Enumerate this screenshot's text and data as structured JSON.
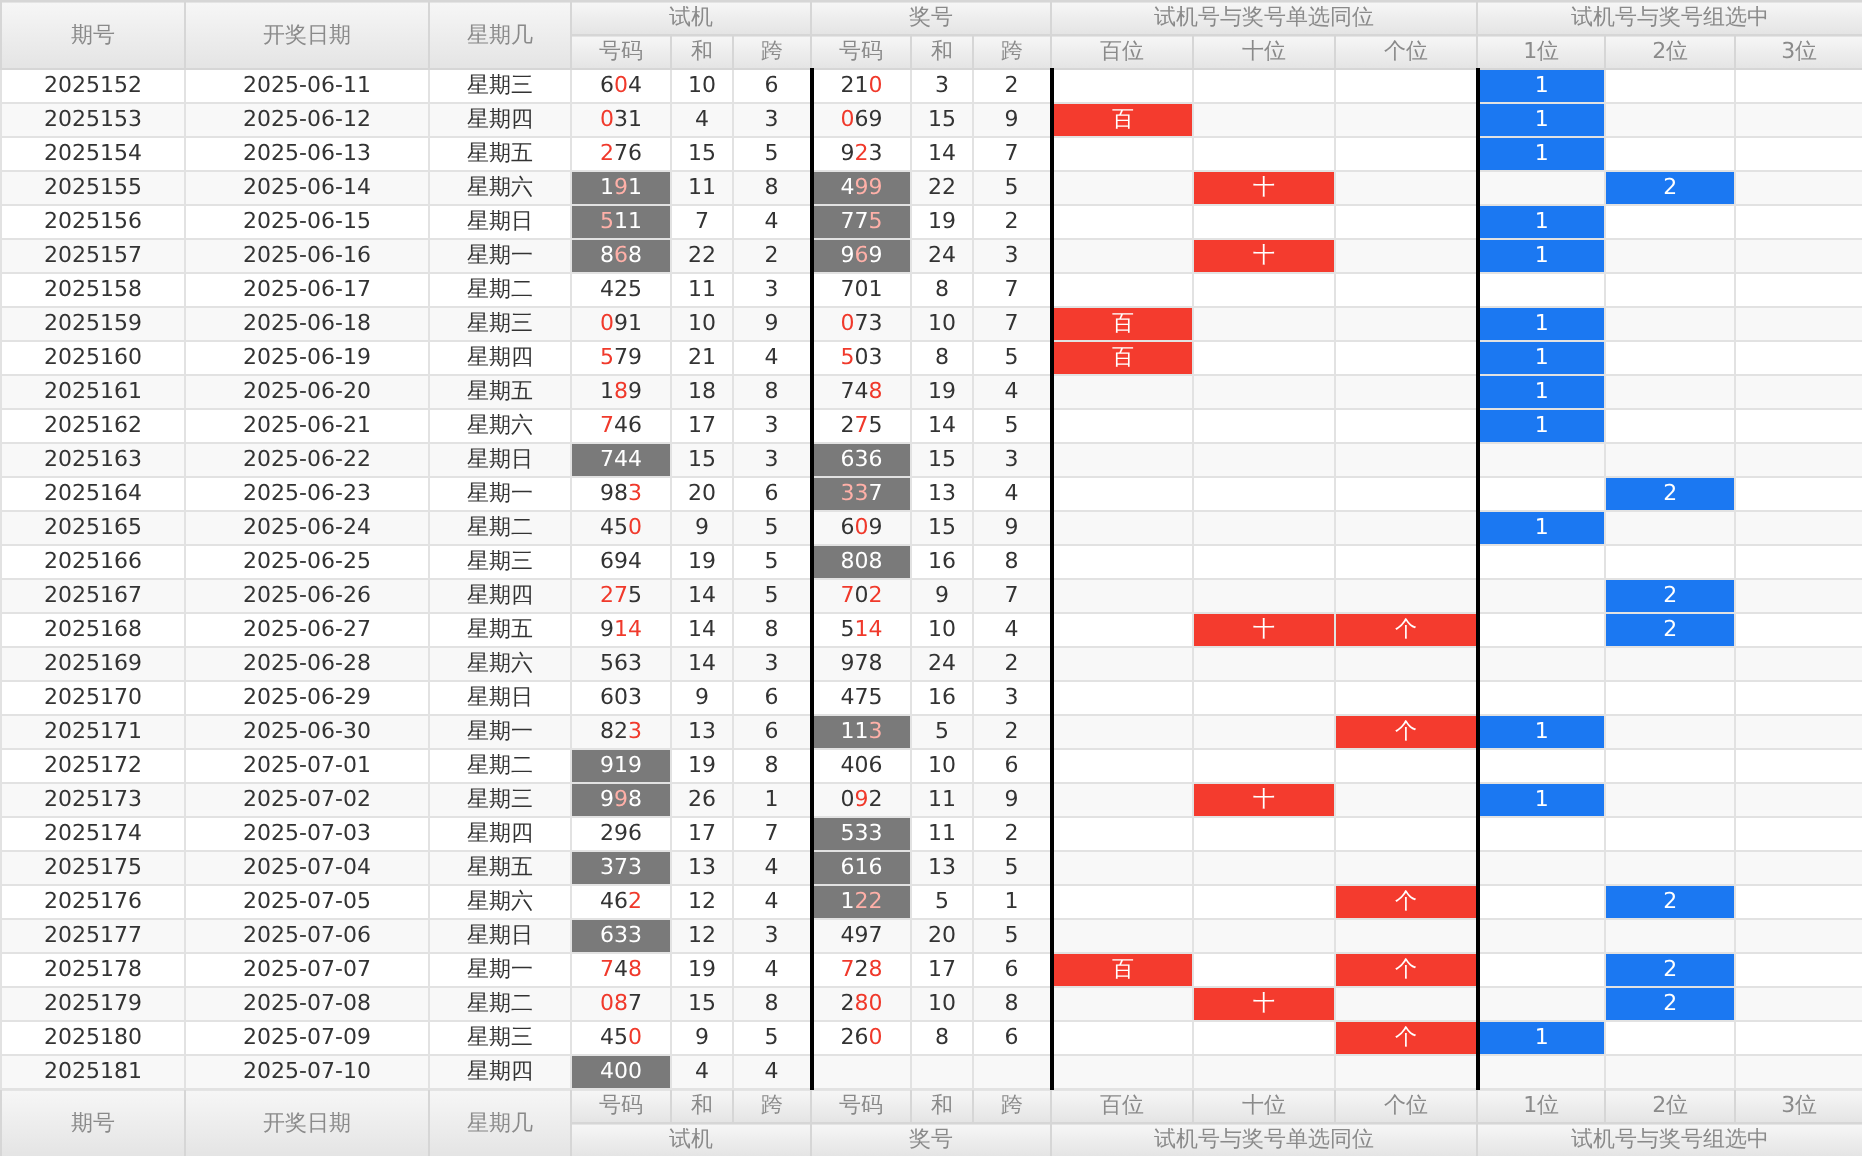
{
  "header": {
    "period": "期号",
    "date": "开奖日期",
    "weekday": "星期几",
    "groups": [
      "试机",
      "奖号",
      "试机号与奖号单选同位",
      "试机号与奖号组选中"
    ],
    "columns": [
      "号码",
      "和",
      "跨",
      "号码",
      "和",
      "跨",
      "百位",
      "十位",
      "个位",
      "1位",
      "2位",
      "3位"
    ]
  },
  "footer": {
    "period": "期号",
    "date": "开奖日期",
    "weekday": "星期几",
    "columns": [
      "号码",
      "和",
      "跨",
      "号码",
      "和",
      "跨",
      "百位",
      "十位",
      "个位",
      "1位",
      "2位",
      "3位"
    ],
    "groups": [
      "试机",
      "奖号",
      "试机号与奖号单选同位",
      "试机号与奖号组选中"
    ]
  },
  "rows": [
    {
      "period": "2025152",
      "date": "2025-06-11",
      "weekday": "星期三",
      "test": {
        "code": "604",
        "hits": [
          false,
          true,
          false
        ],
        "shaded": false,
        "sum": "10",
        "span": "6"
      },
      "draw": {
        "code": "210",
        "hits": [
          false,
          false,
          true
        ],
        "shaded": false,
        "sum": "3",
        "span": "2"
      },
      "single": {},
      "group": {
        "first": "1"
      }
    },
    {
      "period": "2025153",
      "date": "2025-06-12",
      "weekday": "星期四",
      "test": {
        "code": "031",
        "hits": [
          true,
          false,
          false
        ],
        "shaded": false,
        "sum": "4",
        "span": "3"
      },
      "draw": {
        "code": "069",
        "hits": [
          true,
          false,
          false
        ],
        "shaded": false,
        "sum": "15",
        "span": "9"
      },
      "single": {
        "hundreds": "百"
      },
      "group": {
        "first": "1"
      }
    },
    {
      "period": "2025154",
      "date": "2025-06-13",
      "weekday": "星期五",
      "test": {
        "code": "276",
        "hits": [
          true,
          false,
          false
        ],
        "shaded": false,
        "sum": "15",
        "span": "5"
      },
      "draw": {
        "code": "923",
        "hits": [
          false,
          true,
          false
        ],
        "shaded": false,
        "sum": "14",
        "span": "7"
      },
      "single": {},
      "group": {
        "first": "1"
      }
    },
    {
      "period": "2025155",
      "date": "2025-06-14",
      "weekday": "星期六",
      "test": {
        "code": "191",
        "hits": [
          false,
          true,
          false
        ],
        "shaded": true,
        "sum": "11",
        "span": "8"
      },
      "draw": {
        "code": "499",
        "hits": [
          false,
          true,
          true
        ],
        "shaded": true,
        "sum": "22",
        "span": "5"
      },
      "single": {
        "tens": "十"
      },
      "group": {
        "second": "2"
      }
    },
    {
      "period": "2025156",
      "date": "2025-06-15",
      "weekday": "星期日",
      "test": {
        "code": "511",
        "hits": [
          true,
          false,
          false
        ],
        "shaded": true,
        "sum": "7",
        "span": "4"
      },
      "draw": {
        "code": "775",
        "hits": [
          false,
          false,
          true
        ],
        "shaded": true,
        "sum": "19",
        "span": "2"
      },
      "single": {},
      "group": {
        "first": "1"
      }
    },
    {
      "period": "2025157",
      "date": "2025-06-16",
      "weekday": "星期一",
      "test": {
        "code": "868",
        "hits": [
          false,
          true,
          false
        ],
        "shaded": true,
        "sum": "22",
        "span": "2"
      },
      "draw": {
        "code": "969",
        "hits": [
          false,
          true,
          false
        ],
        "shaded": true,
        "sum": "24",
        "span": "3"
      },
      "single": {
        "tens": "十"
      },
      "group": {
        "first": "1"
      }
    },
    {
      "period": "2025158",
      "date": "2025-06-17",
      "weekday": "星期二",
      "test": {
        "code": "425",
        "hits": [
          false,
          false,
          false
        ],
        "shaded": false,
        "sum": "11",
        "span": "3"
      },
      "draw": {
        "code": "701",
        "hits": [
          false,
          false,
          false
        ],
        "shaded": false,
        "sum": "8",
        "span": "7"
      },
      "single": {},
      "group": {}
    },
    {
      "period": "2025159",
      "date": "2025-06-18",
      "weekday": "星期三",
      "test": {
        "code": "091",
        "hits": [
          true,
          false,
          false
        ],
        "shaded": false,
        "sum": "10",
        "span": "9"
      },
      "draw": {
        "code": "073",
        "hits": [
          true,
          false,
          false
        ],
        "shaded": false,
        "sum": "10",
        "span": "7"
      },
      "single": {
        "hundreds": "百"
      },
      "group": {
        "first": "1"
      }
    },
    {
      "period": "2025160",
      "date": "2025-06-19",
      "weekday": "星期四",
      "test": {
        "code": "579",
        "hits": [
          true,
          false,
          false
        ],
        "shaded": false,
        "sum": "21",
        "span": "4"
      },
      "draw": {
        "code": "503",
        "hits": [
          true,
          false,
          false
        ],
        "shaded": false,
        "sum": "8",
        "span": "5"
      },
      "single": {
        "hundreds": "百"
      },
      "group": {
        "first": "1"
      }
    },
    {
      "period": "2025161",
      "date": "2025-06-20",
      "weekday": "星期五",
      "test": {
        "code": "189",
        "hits": [
          false,
          true,
          false
        ],
        "shaded": false,
        "sum": "18",
        "span": "8"
      },
      "draw": {
        "code": "748",
        "hits": [
          false,
          false,
          true
        ],
        "shaded": false,
        "sum": "19",
        "span": "4"
      },
      "single": {},
      "group": {
        "first": "1"
      }
    },
    {
      "period": "2025162",
      "date": "2025-06-21",
      "weekday": "星期六",
      "test": {
        "code": "746",
        "hits": [
          true,
          false,
          false
        ],
        "shaded": false,
        "sum": "17",
        "span": "3"
      },
      "draw": {
        "code": "275",
        "hits": [
          false,
          true,
          false
        ],
        "shaded": false,
        "sum": "14",
        "span": "5"
      },
      "single": {},
      "group": {
        "first": "1"
      }
    },
    {
      "period": "2025163",
      "date": "2025-06-22",
      "weekday": "星期日",
      "test": {
        "code": "744",
        "hits": [
          false,
          false,
          false
        ],
        "shaded": true,
        "sum": "15",
        "span": "3"
      },
      "draw": {
        "code": "636",
        "hits": [
          false,
          false,
          false
        ],
        "shaded": true,
        "sum": "15",
        "span": "3"
      },
      "single": {},
      "group": {}
    },
    {
      "period": "2025164",
      "date": "2025-06-23",
      "weekday": "星期一",
      "test": {
        "code": "983",
        "hits": [
          false,
          false,
          true
        ],
        "shaded": false,
        "sum": "20",
        "span": "6"
      },
      "draw": {
        "code": "337",
        "hits": [
          true,
          true,
          false
        ],
        "shaded": true,
        "sum": "13",
        "span": "4"
      },
      "single": {},
      "group": {
        "second": "2"
      }
    },
    {
      "period": "2025165",
      "date": "2025-06-24",
      "weekday": "星期二",
      "test": {
        "code": "450",
        "hits": [
          false,
          false,
          true
        ],
        "shaded": false,
        "sum": "9",
        "span": "5"
      },
      "draw": {
        "code": "609",
        "hits": [
          false,
          true,
          false
        ],
        "shaded": false,
        "sum": "15",
        "span": "9"
      },
      "single": {},
      "group": {
        "first": "1"
      }
    },
    {
      "period": "2025166",
      "date": "2025-06-25",
      "weekday": "星期三",
      "test": {
        "code": "694",
        "hits": [
          false,
          false,
          false
        ],
        "shaded": false,
        "sum": "19",
        "span": "5"
      },
      "draw": {
        "code": "808",
        "hits": [
          false,
          false,
          false
        ],
        "shaded": true,
        "sum": "16",
        "span": "8"
      },
      "single": {},
      "group": {}
    },
    {
      "period": "2025167",
      "date": "2025-06-26",
      "weekday": "星期四",
      "test": {
        "code": "275",
        "hits": [
          true,
          true,
          false
        ],
        "shaded": false,
        "sum": "14",
        "span": "5"
      },
      "draw": {
        "code": "702",
        "hits": [
          true,
          false,
          true
        ],
        "shaded": false,
        "sum": "9",
        "span": "7"
      },
      "single": {},
      "group": {
        "second": "2"
      }
    },
    {
      "period": "2025168",
      "date": "2025-06-27",
      "weekday": "星期五",
      "test": {
        "code": "914",
        "hits": [
          false,
          true,
          true
        ],
        "shaded": false,
        "sum": "14",
        "span": "8"
      },
      "draw": {
        "code": "514",
        "hits": [
          false,
          true,
          true
        ],
        "shaded": false,
        "sum": "10",
        "span": "4"
      },
      "single": {
        "tens": "十",
        "units": "个"
      },
      "group": {
        "second": "2"
      }
    },
    {
      "period": "2025169",
      "date": "2025-06-28",
      "weekday": "星期六",
      "test": {
        "code": "563",
        "hits": [
          false,
          false,
          false
        ],
        "shaded": false,
        "sum": "14",
        "span": "3"
      },
      "draw": {
        "code": "978",
        "hits": [
          false,
          false,
          false
        ],
        "shaded": false,
        "sum": "24",
        "span": "2"
      },
      "single": {},
      "group": {}
    },
    {
      "period": "2025170",
      "date": "2025-06-29",
      "weekday": "星期日",
      "test": {
        "code": "603",
        "hits": [
          false,
          false,
          false
        ],
        "shaded": false,
        "sum": "9",
        "span": "6"
      },
      "draw": {
        "code": "475",
        "hits": [
          false,
          false,
          false
        ],
        "shaded": false,
        "sum": "16",
        "span": "3"
      },
      "single": {},
      "group": {}
    },
    {
      "period": "2025171",
      "date": "2025-06-30",
      "weekday": "星期一",
      "test": {
        "code": "823",
        "hits": [
          false,
          false,
          true
        ],
        "shaded": false,
        "sum": "13",
        "span": "6"
      },
      "draw": {
        "code": "113",
        "hits": [
          false,
          false,
          true
        ],
        "shaded": true,
        "sum": "5",
        "span": "2"
      },
      "single": {
        "units": "个"
      },
      "group": {
        "first": "1"
      }
    },
    {
      "period": "2025172",
      "date": "2025-07-01",
      "weekday": "星期二",
      "test": {
        "code": "919",
        "hits": [
          false,
          false,
          false
        ],
        "shaded": true,
        "sum": "19",
        "span": "8"
      },
      "draw": {
        "code": "406",
        "hits": [
          false,
          false,
          false
        ],
        "shaded": false,
        "sum": "10",
        "span": "6"
      },
      "single": {},
      "group": {}
    },
    {
      "period": "2025173",
      "date": "2025-07-02",
      "weekday": "星期三",
      "test": {
        "code": "998",
        "hits": [
          false,
          true,
          false
        ],
        "shaded": true,
        "sum": "26",
        "span": "1"
      },
      "draw": {
        "code": "092",
        "hits": [
          false,
          true,
          false
        ],
        "shaded": false,
        "sum": "11",
        "span": "9"
      },
      "single": {
        "tens": "十"
      },
      "group": {
        "first": "1"
      }
    },
    {
      "period": "2025174",
      "date": "2025-07-03",
      "weekday": "星期四",
      "test": {
        "code": "296",
        "hits": [
          false,
          false,
          false
        ],
        "shaded": false,
        "sum": "17",
        "span": "7"
      },
      "draw": {
        "code": "533",
        "hits": [
          false,
          false,
          false
        ],
        "shaded": true,
        "sum": "11",
        "span": "2"
      },
      "single": {},
      "group": {}
    },
    {
      "period": "2025175",
      "date": "2025-07-04",
      "weekday": "星期五",
      "test": {
        "code": "373",
        "hits": [
          false,
          false,
          false
        ],
        "shaded": true,
        "sum": "13",
        "span": "4"
      },
      "draw": {
        "code": "616",
        "hits": [
          false,
          false,
          false
        ],
        "shaded": true,
        "sum": "13",
        "span": "5"
      },
      "single": {},
      "group": {}
    },
    {
      "period": "2025176",
      "date": "2025-07-05",
      "weekday": "星期六",
      "test": {
        "code": "462",
        "hits": [
          false,
          false,
          true
        ],
        "shaded": false,
        "sum": "12",
        "span": "4"
      },
      "draw": {
        "code": "122",
        "hits": [
          false,
          true,
          true
        ],
        "shaded": true,
        "sum": "5",
        "span": "1"
      },
      "single": {
        "units": "个"
      },
      "group": {
        "second": "2"
      }
    },
    {
      "period": "2025177",
      "date": "2025-07-06",
      "weekday": "星期日",
      "test": {
        "code": "633",
        "hits": [
          false,
          false,
          false
        ],
        "shaded": true,
        "sum": "12",
        "span": "3"
      },
      "draw": {
        "code": "497",
        "hits": [
          false,
          false,
          false
        ],
        "shaded": false,
        "sum": "20",
        "span": "5"
      },
      "single": {},
      "group": {}
    },
    {
      "period": "2025178",
      "date": "2025-07-07",
      "weekday": "星期一",
      "test": {
        "code": "748",
        "hits": [
          true,
          false,
          true
        ],
        "shaded": false,
        "sum": "19",
        "span": "4"
      },
      "draw": {
        "code": "728",
        "hits": [
          true,
          false,
          true
        ],
        "shaded": false,
        "sum": "17",
        "span": "6"
      },
      "single": {
        "hundreds": "百",
        "units": "个"
      },
      "group": {
        "second": "2"
      }
    },
    {
      "period": "2025179",
      "date": "2025-07-08",
      "weekday": "星期二",
      "test": {
        "code": "087",
        "hits": [
          true,
          true,
          false
        ],
        "shaded": false,
        "sum": "15",
        "span": "8"
      },
      "draw": {
        "code": "280",
        "hits": [
          false,
          true,
          true
        ],
        "shaded": false,
        "sum": "10",
        "span": "8"
      },
      "single": {
        "tens": "十"
      },
      "group": {
        "second": "2"
      }
    },
    {
      "period": "2025180",
      "date": "2025-07-09",
      "weekday": "星期三",
      "test": {
        "code": "450",
        "hits": [
          false,
          false,
          true
        ],
        "shaded": false,
        "sum": "9",
        "span": "5"
      },
      "draw": {
        "code": "260",
        "hits": [
          false,
          false,
          true
        ],
        "shaded": false,
        "sum": "8",
        "span": "6"
      },
      "single": {
        "units": "个"
      },
      "group": {
        "first": "1"
      }
    },
    {
      "period": "2025181",
      "date": "2025-07-10",
      "weekday": "星期四",
      "test": {
        "code": "400",
        "hits": [
          false,
          false,
          false
        ],
        "shaded": true,
        "sum": "4",
        "span": "4"
      },
      "single": {},
      "group": {}
    }
  ]
}
